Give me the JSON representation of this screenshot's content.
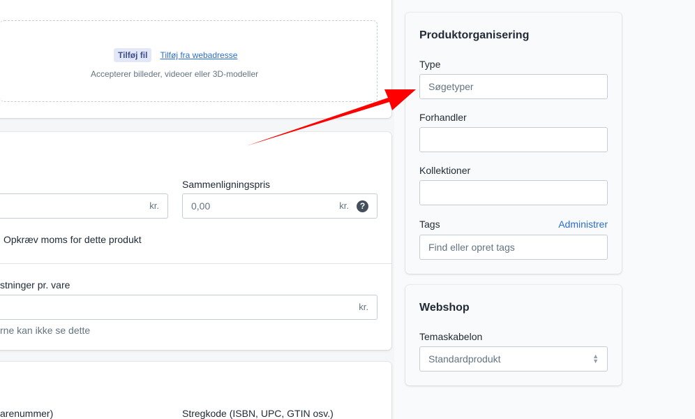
{
  "media": {
    "add_file_button": "Tilføj fil",
    "add_url_link": "Tilføj fra webadresse",
    "accept_text": "Accepterer billeder, videoer eller 3D-modeller"
  },
  "pricing": {
    "price_suffix": "kr.",
    "compare_label": "Sammenligningspris",
    "compare_value": "0,00",
    "compare_suffix": "kr.",
    "tax_label": "Opkræv moms for dette produkt",
    "cost_label": "stninger pr. vare",
    "cost_suffix": "kr.",
    "cost_help": "rne kan ikke se dette"
  },
  "inventory": {
    "sku_label": "arenummer)",
    "barcode_label": "Stregkode (ISBN, UPC, GTIN osv.)"
  },
  "organization": {
    "title": "Produktorganisering",
    "type_label": "Type",
    "type_placeholder": "Søgetyper",
    "vendor_label": "Forhandler",
    "collections_label": "Kollektioner",
    "tags_label": "Tags",
    "manage_link": "Administrer",
    "tags_placeholder": "Find eller opret tags"
  },
  "webshop": {
    "title": "Webshop",
    "template_label": "Temaskabelon",
    "template_value": "Standardprodukt"
  },
  "colors": {
    "accent": "#2c6ecb",
    "annotation_arrow": "#ff0000"
  },
  "icons": {
    "help": "question-circle-icon",
    "select": "chevron-up-down-icon"
  }
}
